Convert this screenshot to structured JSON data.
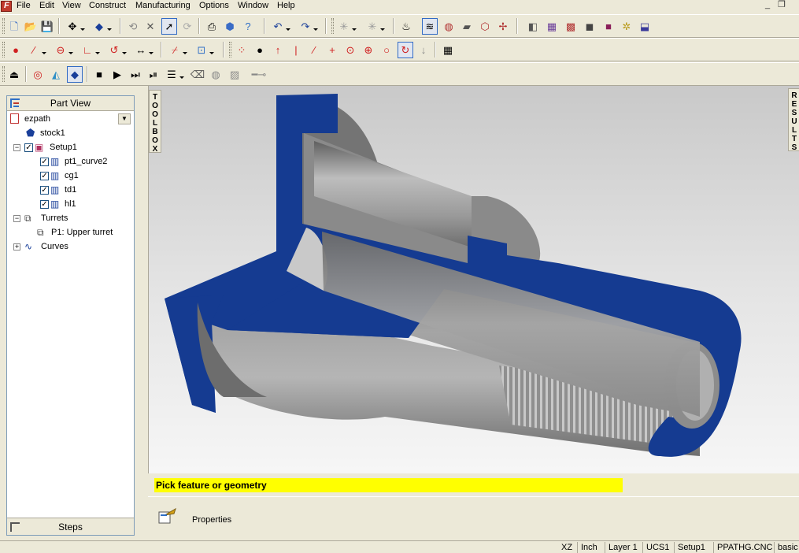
{
  "menubar": {
    "items": [
      "File",
      "Edit",
      "View",
      "Construct",
      "Manufacturing",
      "Options",
      "Window",
      "Help"
    ]
  },
  "toolbars": {
    "row1_icons": [
      "new-file-icon",
      "open-folder-icon",
      "save-icon",
      "move-icon",
      "view-orient-icon",
      "undo-icon",
      "delete-icon",
      "select-arrow-icon",
      "redo-icon",
      "print-preview-icon",
      "model-icon",
      "help-icon",
      "rotate-arc-icon",
      "spin-icon",
      "point-star-icon",
      "point-cluster-icon",
      "tool-holder-icon",
      "toolpath-icon",
      "feature-icon",
      "simulate-icon",
      "transform-icon",
      "move-3d-icon",
      "cut-view-icon",
      "grid-icon",
      "color-icon",
      "shade-icon",
      "stock-icon",
      "gear-icon",
      "render-icon"
    ],
    "row2_icons": [
      "point-icon",
      "line-icon",
      "circle-icon",
      "angle-icon",
      "arc-icon",
      "dimension-icon",
      "trim-icon",
      "rect-icon",
      "grid-points-icon",
      "dot-icon",
      "vertical-line-icon",
      "arrow-up-icon",
      "diagonal-line-icon",
      "crosshair-icon",
      "center-point-icon",
      "target-icon",
      "circle-select-icon",
      "spiral-icon",
      "grid-snap-icon"
    ],
    "row3_icons": [
      "eject-icon",
      "contour-icon",
      "layer-icon",
      "shaded-icon",
      "stop-icon",
      "play-icon",
      "fast-forward-icon",
      "step-icon",
      "list-icon",
      "eraser-icon",
      "globe-icon",
      "image-icon",
      "slider-icon"
    ]
  },
  "part_view": {
    "title": "Part View",
    "file": "ezpath",
    "steps_label": "Steps",
    "tree": [
      {
        "label": "stock1",
        "indent": 0
      },
      {
        "label": "Setup1",
        "indent": 0
      },
      {
        "label": "pt1_curve2",
        "indent": 1
      },
      {
        "label": "cg1",
        "indent": 1
      },
      {
        "label": "td1",
        "indent": 1
      },
      {
        "label": "hl1",
        "indent": 1
      },
      {
        "label": "Turrets",
        "indent": 0
      },
      {
        "label": "P1: Upper turret",
        "indent": 1
      },
      {
        "label": "Curves",
        "indent": 0
      }
    ]
  },
  "side_tabs": {
    "toolbox": "TOOLBOX",
    "results": "RESULTS"
  },
  "status_message": "Pick feature or geometry",
  "properties_label": "Properties",
  "statusbar": {
    "plane": "XZ",
    "units": "Inch",
    "layer": "Layer 1",
    "ucs": "UCS1",
    "setup": "Setup1",
    "post": "PPATHG.CNC",
    "mode": "basic"
  },
  "colors": {
    "section_face": "#153b91",
    "metal_light": "#a9a9a9",
    "metal_dark": "#6b6b6b",
    "status_highlight": "#ffff00"
  }
}
